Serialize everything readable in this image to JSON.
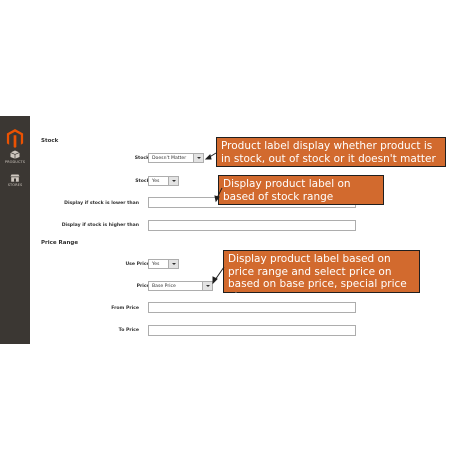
{
  "sidebar": {
    "items": [
      {
        "label": "PRODUCTS",
        "icon": "box-icon"
      },
      {
        "label": "STORES",
        "icon": "store-icon"
      }
    ]
  },
  "form": {
    "stock": {
      "title": "Stock",
      "stock_status_label": "Stock Status",
      "stock_status_value": "Doesn't Matter",
      "stock_range_label": "Stock Range",
      "stock_range_value": "Yes",
      "lower_label": "Display if stock is lower than",
      "higher_label": "Display if stock is higher than"
    },
    "price": {
      "title": "Price Range",
      "use_price_range_label": "Use Price Range",
      "use_price_range_value": "Yes",
      "price_range_label": "Price Range",
      "price_range_value": "Base Price",
      "from_label": "From Price",
      "to_label": "To Price"
    },
    "required_mark": "*"
  },
  "callouts": {
    "stock_status": "Product label display whether product is in stock, out of stock or it doesn't matter",
    "stock_range": "Display product label on based of stock range",
    "price_range": "Display product label based on price range and select price on based on base price, special price etc..."
  },
  "colors": {
    "sidebar_bg": "#3b3733",
    "logo": "#eb5202",
    "callout_bg": "#d26a2e"
  }
}
